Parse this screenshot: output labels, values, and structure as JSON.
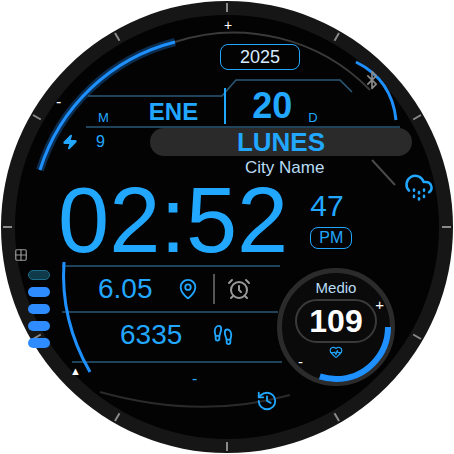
{
  "year": "2025",
  "month": {
    "label": "M",
    "value": "ENE"
  },
  "day": {
    "value": "20",
    "label": "D"
  },
  "battery": {
    "value": "9"
  },
  "weekday": "LUNES",
  "city": "City Name",
  "time": {
    "hours_minutes": "02:52",
    "seconds": "47",
    "period": "PM"
  },
  "distance": "6.05",
  "steps": "6335",
  "heart_rate": {
    "label": "Medio",
    "value": "109",
    "plus": "+",
    "minus": "-",
    "level": 0.3
  },
  "top_gauge": {
    "plus": "+",
    "minus": "-"
  },
  "bottom_mark": "-",
  "scroll_arrow": "▲",
  "battery_segments": [
    {
      "on": false
    },
    {
      "on": true
    },
    {
      "on": true
    },
    {
      "on": true
    },
    {
      "on": true
    }
  ]
}
